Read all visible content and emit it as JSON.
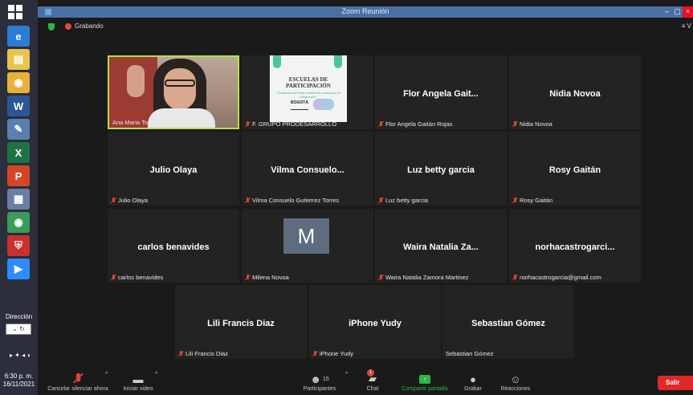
{
  "window": {
    "title": "Zoom Reunión",
    "controls": [
      "–",
      "▢"
    ]
  },
  "recording": {
    "label": "Grabando"
  },
  "view_button": "≡ V",
  "taskbar": {
    "apps": [
      {
        "name": "ie-icon",
        "glyph": "e",
        "color": "#2b7cd3"
      },
      {
        "name": "explorer-icon",
        "glyph": "▤",
        "color": "#e8c54a"
      },
      {
        "name": "chrome-icon",
        "glyph": "◉",
        "color": "#e8b13a"
      },
      {
        "name": "word-icon",
        "glyph": "W",
        "color": "#2b5797"
      },
      {
        "name": "paint-icon",
        "glyph": "✎",
        "color": "#5a7fb0"
      },
      {
        "name": "excel-icon",
        "glyph": "X",
        "color": "#1f7244"
      },
      {
        "name": "powerpoint-icon",
        "glyph": "P",
        "color": "#d24726"
      },
      {
        "name": "calculator-icon",
        "glyph": "▦",
        "color": "#6b7ea6"
      },
      {
        "name": "chrome2-icon",
        "glyph": "◉",
        "color": "#3c9a5a"
      },
      {
        "name": "shield-app-icon",
        "glyph": "⛨",
        "color": "#c8312d"
      },
      {
        "name": "zoom-app-icon",
        "glyph": "▶",
        "color": "#2d8cff"
      }
    ],
    "address_label": "Dirección",
    "address_value": "⌄ ↻",
    "tray": "▸ ✦ ◂ ◖",
    "clock_time": "6:30 p. m.",
    "clock_date": "16/11/2021"
  },
  "tiles": [
    {
      "kind": "video",
      "label": "Ana Maria Torres",
      "muted": false,
      "active": true
    },
    {
      "kind": "poster",
      "label": "F. GRUPO PRODESARROLLO",
      "muted": true,
      "poster_title1": "ESCUELAS DE",
      "poster_title2": "PARTICIPACIÓN",
      "poster_sub": "\"Desarrollo del futuro ambiente social para la integración\"",
      "poster_logo": "BOGOTÁ"
    },
    {
      "kind": "name",
      "display": "Flor Angela Gait...",
      "label": "Flor Angela Gaitán Rojas",
      "muted": true
    },
    {
      "kind": "name",
      "display": "Nidia Novoa",
      "label": "Nidia Novoa",
      "muted": true
    },
    {
      "kind": "name",
      "display": "Julio Olaya",
      "label": "Julio Olaya",
      "muted": true
    },
    {
      "kind": "name",
      "display": "Vilma  Consuelo...",
      "label": "Vilma Consuelo Gutierrez Torres",
      "muted": true
    },
    {
      "kind": "name",
      "display": "Luz betty garcia",
      "label": "Luz betty garcia",
      "muted": true
    },
    {
      "kind": "name",
      "display": "Rosy Gaitán",
      "label": "Rosy Gaitán",
      "muted": true
    },
    {
      "kind": "name",
      "display": "carlos benavides",
      "label": "carlos benavides",
      "muted": true
    },
    {
      "kind": "avatar",
      "initial": "M",
      "label": "Milena Novoa",
      "muted": true
    },
    {
      "kind": "name",
      "display": "Waira Natalia Za...",
      "label": "Waira Natalia Zamora Martinez",
      "muted": true
    },
    {
      "kind": "name",
      "display": "norhacastrogarci...",
      "label": "norhacastrogarcia@gmail.com",
      "muted": true
    },
    {
      "kind": "name",
      "display": "Lili Francis Diaz",
      "label": "Lili Francis Diaz",
      "muted": true
    },
    {
      "kind": "name",
      "display": "iPhone Yudy",
      "label": "iPhone Yudy",
      "muted": true
    },
    {
      "kind": "name",
      "display": "Sebastian Gómez",
      "label": "Sebastian Gómez",
      "muted": false
    }
  ],
  "toolbar": {
    "unmute_label": "Cancelar silenciar ahora",
    "video_label": "Iniciar video",
    "participants_label": "Participantes",
    "participants_count": "15",
    "chat_label": "Chat",
    "chat_badge": "1",
    "share_label": "Compartir pantalla",
    "record_label": "Grabar",
    "reactions_label": "Reacciones",
    "leave_label": "Salir",
    "caret": "^"
  },
  "colors": {
    "share_green": "#2fb34a",
    "active_border": "#b4e33c",
    "leave_red": "#e02828",
    "mute_red": "#e0443a"
  }
}
